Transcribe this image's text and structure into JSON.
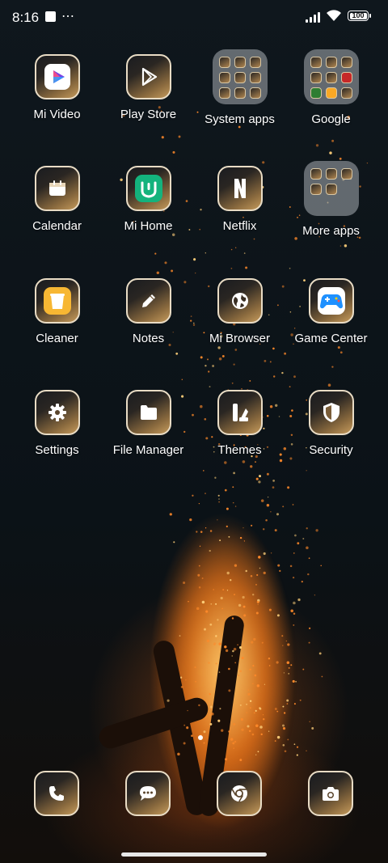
{
  "status_bar": {
    "time": "8:16",
    "notification_dots": "⋯",
    "battery_level": "100",
    "icons": [
      "notification-square-icon",
      "signal-icon",
      "wifi-icon",
      "battery-icon"
    ]
  },
  "apps": [
    {
      "label": "Mi Video",
      "icon": "mi-video-icon"
    },
    {
      "label": "Play Store",
      "icon": "play-store-icon"
    },
    {
      "label": "System apps",
      "icon": "system-apps-folder"
    },
    {
      "label": "Google",
      "icon": "google-folder"
    },
    {
      "label": "Calendar",
      "icon": "calendar-icon"
    },
    {
      "label": "Mi Home",
      "icon": "mi-home-icon"
    },
    {
      "label": "Netflix",
      "icon": "netflix-icon"
    },
    {
      "label": "More apps",
      "icon": "more-apps-folder"
    },
    {
      "label": "Cleaner",
      "icon": "cleaner-icon"
    },
    {
      "label": "Notes",
      "icon": "notes-icon"
    },
    {
      "label": "Mi Browser",
      "icon": "browser-icon"
    },
    {
      "label": "Game Center",
      "icon": "game-center-icon"
    },
    {
      "label": "Settings",
      "icon": "settings-icon"
    },
    {
      "label": "File Manager",
      "icon": "file-manager-icon"
    },
    {
      "label": "Themes",
      "icon": "themes-icon"
    },
    {
      "label": "Security",
      "icon": "security-icon"
    }
  ],
  "dock": [
    {
      "icon": "phone-icon"
    },
    {
      "icon": "messages-icon"
    },
    {
      "icon": "chrome-icon"
    },
    {
      "icon": "camera-icon"
    }
  ],
  "colors": {
    "tile_border": "#e9dcc5",
    "tile_gradient_end": "#c49a5c",
    "folder_bg": "#aaafb4",
    "background": "#0d1419"
  }
}
